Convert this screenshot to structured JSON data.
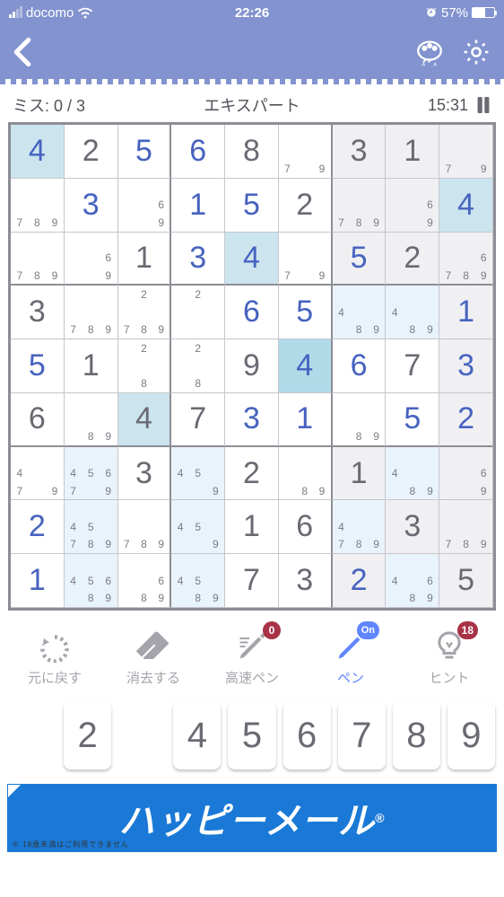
{
  "status": {
    "carrier": "docomo",
    "time": "22:26",
    "battery_pct": "57%",
    "battery_fill": 57
  },
  "info": {
    "mistakes_label": "ミス:",
    "mistakes_value": "0 / 3",
    "difficulty": "エキスパート",
    "timer": "15:31"
  },
  "board": {
    "cells": [
      [
        {
          "v": "4",
          "t": "u",
          "h": "A"
        },
        {
          "v": "2",
          "t": "g"
        },
        {
          "v": "5",
          "t": "u"
        },
        {
          "v": "6",
          "t": "u"
        },
        {
          "v": "8",
          "t": "g"
        },
        {
          "n": [
            7,
            9
          ]
        },
        {
          "v": "3",
          "t": "g",
          "s": 1
        },
        {
          "v": "1",
          "t": "g",
          "s": 1
        },
        {
          "n": [
            7,
            9
          ],
          "s": 1
        }
      ],
      [
        {
          "n": [
            7,
            8,
            9
          ]
        },
        {
          "v": "3",
          "t": "u"
        },
        {
          "n": [
            6,
            9
          ]
        },
        {
          "v": "1",
          "t": "u"
        },
        {
          "v": "5",
          "t": "u"
        },
        {
          "v": "2",
          "t": "g"
        },
        {
          "n": [
            7,
            8,
            9
          ],
          "s": 1
        },
        {
          "n": [
            6,
            9
          ],
          "s": 1
        },
        {
          "v": "4",
          "t": "u",
          "s": 1,
          "h": "A"
        }
      ],
      [
        {
          "n": [
            7,
            8,
            9
          ]
        },
        {
          "n": [
            6,
            9
          ]
        },
        {
          "v": "1",
          "t": "g"
        },
        {
          "v": "3",
          "t": "u"
        },
        {
          "v": "4",
          "t": "u",
          "h": "A"
        },
        {
          "n": [
            7,
            9
          ]
        },
        {
          "v": "5",
          "t": "u",
          "s": 1
        },
        {
          "v": "2",
          "t": "g",
          "s": 1
        },
        {
          "n": [
            6,
            9
          ],
          "s": 1,
          "nr": [
            7,
            8,
            9
          ]
        }
      ],
      [
        {
          "v": "3",
          "t": "g"
        },
        {
          "n": [
            7,
            8,
            9
          ]
        },
        {
          "n": [
            2
          ],
          "nr": [
            7,
            8,
            9
          ]
        },
        {
          "n": [
            2
          ]
        },
        {
          "v": "6",
          "t": "u"
        },
        {
          "v": "5",
          "t": "u"
        },
        {
          "n": [
            4,
            8,
            9
          ],
          "h": "C"
        },
        {
          "n": [
            4,
            8,
            9
          ],
          "h": "C"
        },
        {
          "v": "1",
          "t": "u",
          "s": 1
        }
      ],
      [
        {
          "v": "5",
          "t": "u"
        },
        {
          "v": "1",
          "t": "g"
        },
        {
          "n": [
            2,
            8
          ]
        },
        {
          "n": [
            2,
            8
          ]
        },
        {
          "v": "9",
          "t": "g"
        },
        {
          "v": "4",
          "t": "u",
          "h": "B"
        },
        {
          "v": "6",
          "t": "u"
        },
        {
          "v": "7",
          "t": "g"
        },
        {
          "v": "3",
          "t": "u",
          "s": 1
        }
      ],
      [
        {
          "v": "6",
          "t": "g"
        },
        {
          "n": [
            8,
            9
          ]
        },
        {
          "v": "4",
          "t": "g",
          "h": "A"
        },
        {
          "v": "7",
          "t": "g"
        },
        {
          "v": "3",
          "t": "u"
        },
        {
          "v": "1",
          "t": "u"
        },
        {
          "n": [
            8,
            9
          ]
        },
        {
          "v": "5",
          "t": "u"
        },
        {
          "v": "2",
          "t": "u",
          "s": 1
        }
      ],
      [
        {
          "n": [
            7,
            9
          ],
          "nl": [
            4
          ]
        },
        {
          "n": [
            4,
            5,
            6,
            7,
            9
          ],
          "h": "C"
        },
        {
          "v": "3",
          "t": "g"
        },
        {
          "n": [
            4,
            5,
            9
          ],
          "h": "C"
        },
        {
          "v": "2",
          "t": "g"
        },
        {
          "n": [
            8,
            9
          ]
        },
        {
          "v": "1",
          "t": "g",
          "s": 1
        },
        {
          "n": [
            4,
            8,
            9
          ],
          "s": 1,
          "h": "C"
        },
        {
          "n": [
            6,
            9
          ],
          "s": 1
        }
      ],
      [
        {
          "v": "2",
          "t": "u"
        },
        {
          "n": [
            4,
            5
          ],
          "h": "C",
          "nr": [
            7,
            8,
            9
          ]
        },
        {
          "n": [
            7,
            8,
            9
          ]
        },
        {
          "n": [
            4,
            5,
            9
          ],
          "h": "C"
        },
        {
          "v": "1",
          "t": "g"
        },
        {
          "v": "6",
          "t": "g"
        },
        {
          "n": [
            4,
            7,
            8,
            9
          ],
          "s": 1,
          "h": "C"
        },
        {
          "v": "3",
          "t": "g",
          "s": 1
        },
        {
          "n": [
            7,
            8,
            9
          ],
          "s": 1
        }
      ],
      [
        {
          "v": "1",
          "t": "u"
        },
        {
          "n": [
            4,
            5,
            6,
            8,
            9
          ],
          "h": "C"
        },
        {
          "n": [
            6,
            8,
            9
          ]
        },
        {
          "n": [
            4,
            5,
            8,
            9
          ],
          "h": "C"
        },
        {
          "v": "7",
          "t": "g"
        },
        {
          "v": "3",
          "t": "g"
        },
        {
          "v": "2",
          "t": "u",
          "s": 1
        },
        {
          "n": [
            4,
            6,
            8,
            9
          ],
          "s": 1,
          "h": "C"
        },
        {
          "v": "5",
          "t": "g",
          "s": 1
        }
      ]
    ]
  },
  "tools": {
    "undo": "元に戻す",
    "erase": "消去する",
    "fastpen": "高速ペン",
    "fastpen_badge": "0",
    "pen": "ペン",
    "pen_badge": "On",
    "hint": "ヒント",
    "hint_badge": "18"
  },
  "numpad": [
    "",
    "2",
    "",
    "4",
    "5",
    "6",
    "7",
    "8",
    "9"
  ],
  "ad": {
    "text": "ハッピーメール",
    "note": "※ 18歳未満はご利用できません"
  }
}
